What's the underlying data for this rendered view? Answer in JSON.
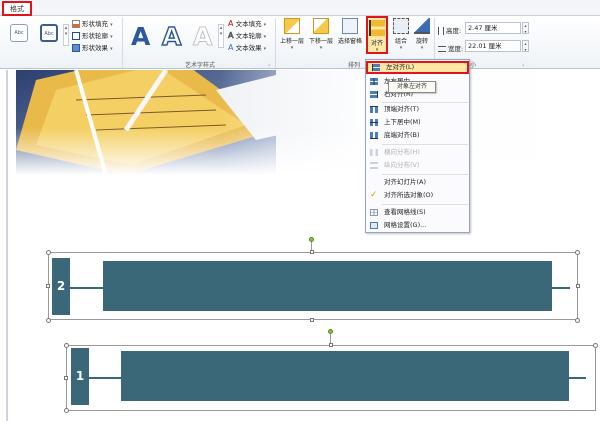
{
  "tabs": {
    "format": "格式"
  },
  "shape_styles": {
    "preset1": "Abc",
    "preset2": "Abc",
    "fill": "形状填充",
    "outline": "形状轮廓",
    "effects": "形状效果"
  },
  "wordart": {
    "text_fill": "文本填充",
    "text_outline": "文本轮廓",
    "text_effects": "文本效果",
    "group_label": "艺术字样式"
  },
  "arrange": {
    "bring_forward": "上移一层",
    "send_backward": "下移一层",
    "selection_pane": "选择窗格",
    "align": "对齐",
    "group": "组合",
    "rotate": "旋转",
    "group_label": "排列"
  },
  "size": {
    "height_label": "高度:",
    "height_value": "2.47 厘米",
    "width_label": "宽度:",
    "width_value": "22.01 厘米",
    "group_label": "大小"
  },
  "menu": {
    "items": [
      {
        "label": "左对齐(L)",
        "icon": "align-left-icon"
      },
      {
        "label": "左右居中",
        "icon": "align-center-icon"
      },
      {
        "label": "右对齐(R)",
        "icon": "align-right-icon"
      },
      {
        "label": "顶端对齐(T)",
        "icon": "align-top-icon"
      },
      {
        "label": "上下居中(M)",
        "icon": "align-middle-icon"
      },
      {
        "label": "底端对齐(B)",
        "icon": "align-bottom-icon"
      },
      {
        "label": "横向分布(H)",
        "icon": "distribute-horizontal-icon"
      },
      {
        "label": "纵向分布(V)",
        "icon": "distribute-vertical-icon"
      },
      {
        "label": "对齐幻灯片(A)",
        "icon": ""
      },
      {
        "label": "对齐所选对象(O)",
        "icon": "checkmark-icon"
      },
      {
        "label": "查看网格线(S)",
        "icon": "gridlines-icon"
      },
      {
        "label": "网格设置(G)...",
        "icon": "grid-settings-icon"
      }
    ],
    "tooltip": "对象左对齐"
  },
  "slide": {
    "shape2_number": "2",
    "shape1_number": "1",
    "shape_color": "#3a6878"
  }
}
